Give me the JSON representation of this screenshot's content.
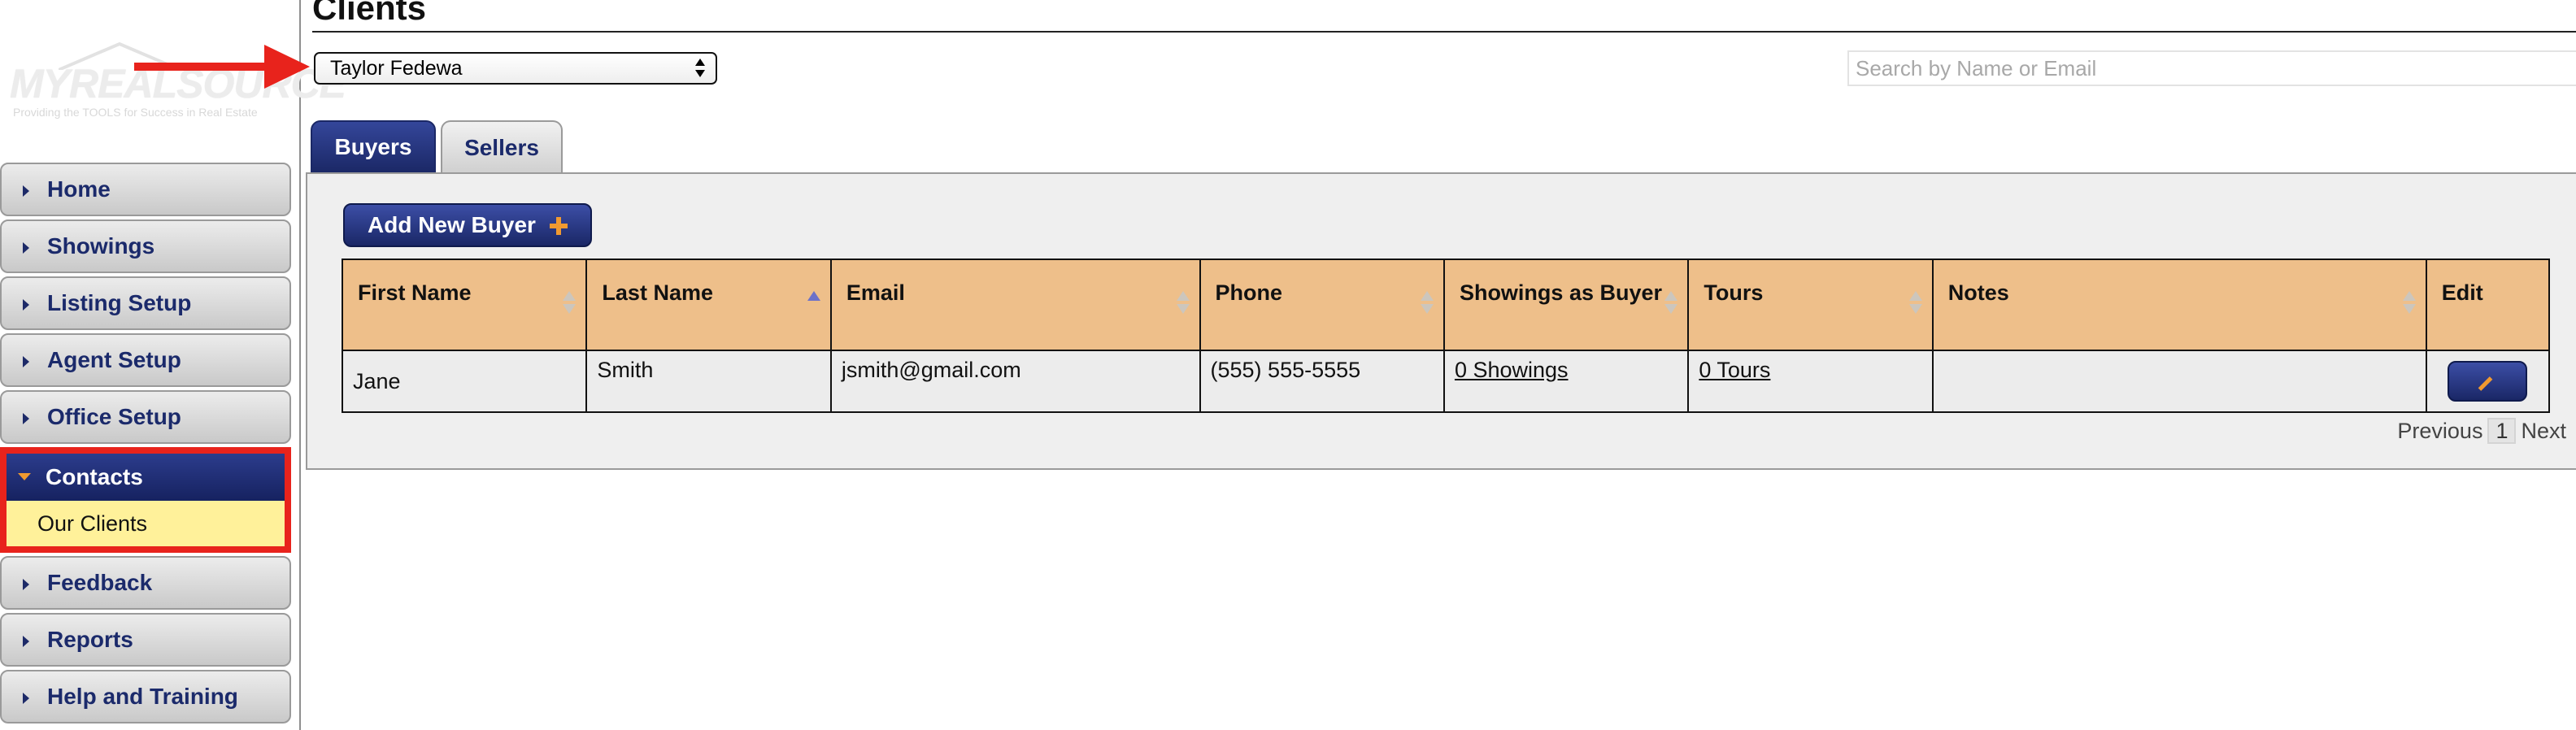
{
  "logo": {
    "text": "MYREALSOURCE",
    "tagline": "Providing the TOOLS for Success in Real Estate"
  },
  "sidebar": {
    "items": [
      {
        "label": "Home"
      },
      {
        "label": "Showings"
      },
      {
        "label": "Listing Setup"
      },
      {
        "label": "Agent Setup"
      },
      {
        "label": "Office Setup"
      },
      {
        "label": "Contacts",
        "active": true,
        "subitems": [
          {
            "label": "Our Clients"
          }
        ]
      },
      {
        "label": "Feedback"
      },
      {
        "label": "Reports"
      },
      {
        "label": "Help and Training"
      }
    ]
  },
  "header": {
    "title": "Clients"
  },
  "client_select": {
    "value": "Taylor Fedewa"
  },
  "search": {
    "placeholder": "Search by Name or Email"
  },
  "tabs": [
    {
      "label": "Buyers",
      "active": true
    },
    {
      "label": "Sellers",
      "active": false
    }
  ],
  "toolbar": {
    "add_label": "Add New Buyer"
  },
  "table": {
    "columns": [
      "First Name",
      "Last Name",
      "Email",
      "Phone",
      "Showings as Buyer",
      "Tours",
      "Notes",
      "Edit"
    ],
    "rows": [
      {
        "first_name": "Jane",
        "last_name": "Smith",
        "email": "jsmith@gmail.com",
        "phone": "(555) 555-5555",
        "showings": "0 Showings",
        "tours": "0 Tours",
        "notes": ""
      }
    ]
  },
  "pagination": {
    "previous": "Previous",
    "page": "1",
    "next": "Next"
  },
  "colors": {
    "nav_blue": "#1b2a6b",
    "header_orange": "#eebf8a",
    "annotation_red": "#e8231c",
    "active_sub_bg": "#fff19a"
  }
}
